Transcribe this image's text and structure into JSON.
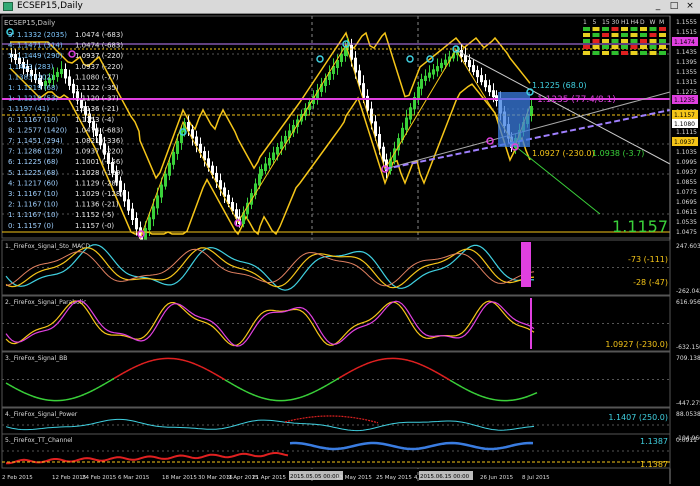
{
  "window": {
    "title": "ECSEP15,Daily",
    "minimize": "_",
    "maximize": "□",
    "close": "×"
  },
  "main": {
    "symbol_label": "ECSEP15,Daily",
    "price_labels": [
      "1.1555",
      "1.1515",
      "1.1475",
      "1.1435",
      "1.1395",
      "1.1355",
      "1.1315",
      "1.1275",
      "1.1235",
      "1.1195",
      "1.1157",
      "1.1115",
      "1.1080",
      "1.1035",
      "1.0995",
      "1.0937",
      "1.0855",
      "1.0775",
      "1.0695",
      "1.0615",
      "1.0535",
      "1.0475"
    ],
    "highlight_labels": {
      "magenta_top": "1.1474",
      "magenta_mid": "1.1235",
      "yellow_price": "1.1157",
      "white_price": "1.1080",
      "cyan_low": "1.0937"
    },
    "left_list_a": [
      "3: 1.1332 (2035)",
      "4: 1.1471 (314)",
      "5: 1.1449 (290)",
      "1.1423 (283)",
      "1.1383 (202)",
      "1: 1.1219 (68)",
      "1: 1.1219 (53)",
      "1.1197 (41)",
      "0: 1.1167 (10)",
      "8: 1.2577 (1420)",
      "7: 1.1451 (294)",
      "7: 1.1286 (129)",
      "6: 1.1225 (68)",
      "5: 1.1225 (68)",
      "4: 1.1217 (60)",
      "3: 1.1167 (10)",
      "2: 1.1167 (10)",
      "1: 1.1167 (10)",
      "0: 1.1157 (0)"
    ],
    "left_list_b": [
      "1.0474 (-683)",
      "1.0474 (-683)",
      "1.0937 (-220)",
      "1.0937 (-220)",
      "1.1080 (-77)",
      "1.1122 (-35)",
      "1.1120 (-37)",
      "1.1136 (-21)",
      "1.1153 (-4)",
      "1.0474 (-683)",
      "1.0821 (-336)",
      "1.0937 (-220)",
      "1.1001 (-156)",
      "1.1028 (-129)",
      "1.1129 (-28)",
      "1.1029 (-128)",
      "1.1136 (-21)",
      "1.1152 (-5)",
      "1.1157 (-0)"
    ],
    "annotations": {
      "fib_a": "1.1225 (68.0)",
      "fib_b": "1.1235 (77.4/8.1)",
      "fib_c": "1.0927 (-230.0)",
      "fib_d": "1.0938 (-3.7)",
      "big_price": "1.1157"
    },
    "tf_header": [
      "1",
      "5",
      "15",
      "30",
      "H1",
      "H4",
      "D",
      "W",
      "M"
    ]
  },
  "indicators": [
    {
      "name": "1._FireFox_Signal_Sto_MACD",
      "scale_top": "247.6030",
      "scale_bottom": "-262.0426",
      "text_a": "-73 (-111)",
      "text_b": "-28 (-47)"
    },
    {
      "name": "2._FireFox_Signal_Parabolic",
      "scale_top": "616.956",
      "scale_bottom": "-632.150",
      "text_a": "1.0927 (-230.0)"
    },
    {
      "name": "3._FireFox_Signal_BB",
      "scale_top": "709.1388",
      "scale_bottom": "-447.275"
    },
    {
      "name": "4._FireFox_Signal_Power",
      "scale_top": "88.0538",
      "scale_bottom": "-104.966",
      "text_a": "1.1407 (250.0)"
    },
    {
      "name": "5._FireFox_TT_Channel",
      "scale_top": "0.0911",
      "scale_bottom": "",
      "text_a": "1.1387",
      "text_b": "1.1387"
    }
  ],
  "time_axis": [
    "2 Feb 2015",
    "12 Feb 2015",
    "24 Feb 2015",
    "6 Mar 2015",
    "18 Mar 2015",
    "30 Mar 2015",
    "9 Apr 2015",
    "21 Apr 2015",
    "2015.05.05 00:00",
    "13 May 2015",
    "25 May 2015",
    "4 Jun",
    "2015.06.15 00:00",
    "26 Jun 2015",
    "8 Jul 2015"
  ],
  "colors": {
    "up": "#3ad13a",
    "down": "#ffffff",
    "channel": "#f5c518",
    "magenta": "#e040e0",
    "cyan": "#40d0e0",
    "red": "#e02020",
    "blue": "#3a7ce0",
    "grid": "#444"
  }
}
